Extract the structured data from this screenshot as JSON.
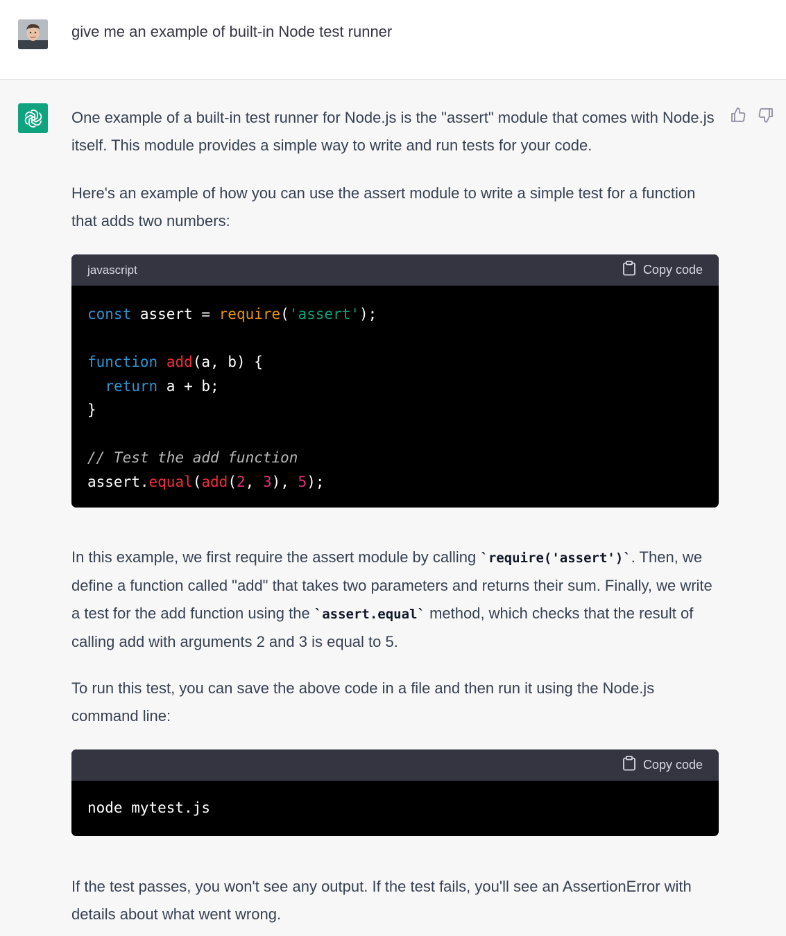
{
  "user": {
    "message": "give me an example of built-in Node test runner"
  },
  "assistant": {
    "p1": "One example of a built-in test runner for Node.js is the \"assert\" module that comes with Node.js itself. This module provides a simple way to write and run tests for your code.",
    "p2": "Here's an example of how you can use the assert module to write a simple test for a function that adds two numbers:",
    "code1": {
      "language": "javascript",
      "copy_label": "Copy code",
      "lines": [
        [
          "const",
          " assert = ",
          "require",
          "(",
          "'assert'",
          ");"
        ],
        [],
        [
          "function",
          " ",
          "add",
          "(a, b) {"
        ],
        [
          "  ",
          "return",
          " a + b;"
        ],
        [
          "}"
        ],
        [],
        [
          "// Test the add function"
        ],
        [
          "assert.",
          "equal",
          "(",
          "add",
          "(",
          "2",
          ", ",
          "3",
          "), ",
          "5",
          ");"
        ]
      ]
    },
    "p3": {
      "a": "In this example, we first require the assert module by calling ",
      "code_a": "`require('assert')`",
      "b": ". Then, we define a function called \"add\" that takes two parameters and returns their sum. Finally, we write a test for the add function using the ",
      "code_b": "`assert.equal`",
      "c": " method, which checks that the result of calling add with arguments 2 and 3 is equal to 5."
    },
    "p4": "To run this test, you can save the above code in a file and then run it using the Node.js command line:",
    "code2": {
      "copy_label": "Copy code",
      "text": "node mytest.js"
    },
    "p5": "If the test passes, you won't see any output. If the test fails, you'll see an AssertionError with details about what went wrong."
  },
  "icons": {
    "avatar": "user-avatar",
    "logo": "chatgpt-logo-icon",
    "thumbs_up": "thumbs-up-icon",
    "thumbs_down": "thumbs-down-icon",
    "clipboard": "clipboard-icon"
  },
  "colors": {
    "logo_bg": "#10a37f",
    "code_header_bg": "#343541",
    "code_bg": "#000000",
    "keyword": "#2e95d3",
    "function": "#f22c3d",
    "string": "#00a67d",
    "number": "#df3079"
  }
}
